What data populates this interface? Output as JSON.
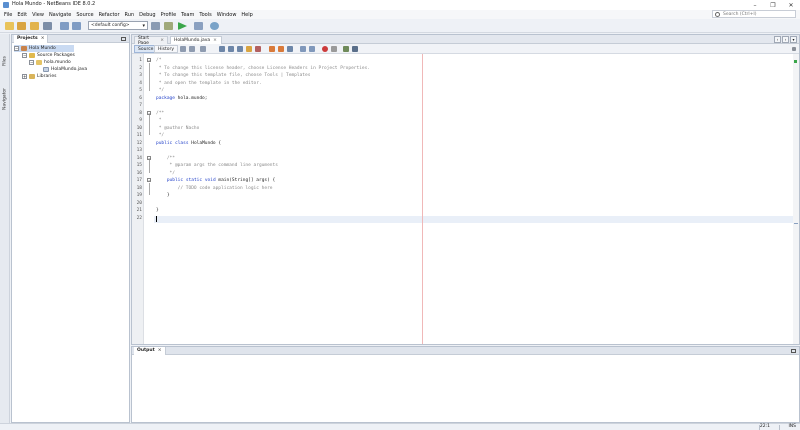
{
  "window": {
    "title": "Hola Mundo - NetBeans IDE 8.0.2"
  },
  "menu": [
    "File",
    "Edit",
    "View",
    "Navigate",
    "Source",
    "Refactor",
    "Run",
    "Debug",
    "Profile",
    "Team",
    "Tools",
    "Window",
    "Help"
  ],
  "search": {
    "placeholder": "Search (Ctrl+I)"
  },
  "toolbar": {
    "config_value": "<default config>"
  },
  "side_tabs": {
    "files": "Files",
    "navigator": "Navigator"
  },
  "projects": {
    "tab_label": "Projects",
    "tree": [
      {
        "label": "Hola Mundo",
        "level": 0,
        "toggle": "−",
        "selected": true,
        "icon": "project-icon"
      },
      {
        "label": "Source Packages",
        "level": 1,
        "toggle": "−",
        "icon": "folder-icon"
      },
      {
        "label": "hola.mundo",
        "level": 2,
        "toggle": "−",
        "icon": "package-icon"
      },
      {
        "label": "HolaMundo.java",
        "level": 3,
        "toggle": "",
        "icon": "java-file-icon"
      },
      {
        "label": "Libraries",
        "level": 1,
        "toggle": "+",
        "icon": "library-icon"
      }
    ]
  },
  "editor": {
    "tabs": [
      {
        "label": "Start Page",
        "active": false
      },
      {
        "label": "HolaMundo.java",
        "active": true
      }
    ],
    "modes": {
      "source": "Source",
      "history": "History"
    },
    "line_numbers": [
      "1",
      "2",
      "3",
      "4",
      "5",
      "6",
      "7",
      "8",
      "9",
      "10",
      "11",
      "12",
      "13",
      "14",
      "15",
      "16",
      "17",
      "18",
      "19",
      "20",
      "21",
      "22"
    ],
    "lines": [
      "/*",
      " * To change this license header, choose License Headers in Project Properties.",
      " * To change this template file, choose Tools | Templates",
      " * and open the template in the editor.",
      " */",
      "package hola.mundo;",
      "",
      "/**",
      " *",
      " * @author Nacho",
      " */",
      "public class HolaMundo {",
      "",
      "    /**",
      "     * @param args the command line arguments",
      "     */",
      "    public static void main(String[] args) {",
      "        // TODO code application logic here",
      "    }",
      "",
      "}",
      ""
    ]
  },
  "output": {
    "tab_label": "Output"
  },
  "status": {
    "position": "22:1",
    "mode": "INS"
  }
}
